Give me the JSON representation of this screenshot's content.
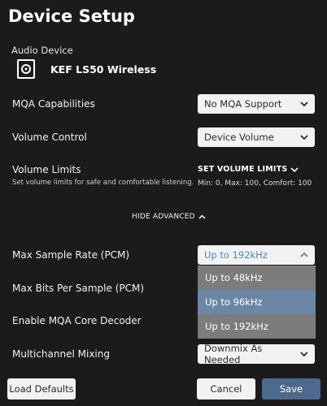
{
  "title": "Device Setup",
  "audio_device": {
    "label": "Audio Device",
    "icon": "speaker-icon",
    "name": "KEF LS50 Wireless"
  },
  "mqa": {
    "label": "MQA Capabilities",
    "value": "No MQA Support"
  },
  "volume_control": {
    "label": "Volume Control",
    "value": "Device Volume"
  },
  "volume_limits": {
    "label": "Volume Limits",
    "description": "Set volume limits for safe and comfortable listening.",
    "link": "SET VOLUME LIMITS",
    "values": "Min: 0, Max: 100, Comfort: 100"
  },
  "advanced_toggle": "HIDE ADVANCED",
  "max_sample_rate": {
    "label": "Max Sample Rate (PCM)",
    "value": "Up to 192kHz",
    "options": [
      "Up to 48kHz",
      "Up to 96kHz",
      "Up to 192kHz"
    ],
    "highlighted_option": "Up to 96kHz"
  },
  "max_bits": {
    "label": "Max Bits Per Sample (PCM)"
  },
  "mqa_decoder": {
    "label": "Enable MQA Core Decoder"
  },
  "multichannel": {
    "label": "Multichannel Mixing",
    "value": "Downmix As Needed"
  },
  "buttons": {
    "load_defaults": "Load Defaults",
    "cancel": "Cancel",
    "save": "Save"
  },
  "colors": {
    "background": "#1b1b1b",
    "accent": "#4b6a8d",
    "dropdown_highlight": "#6c87a6",
    "dropdown_item": "#7c7c7c"
  }
}
